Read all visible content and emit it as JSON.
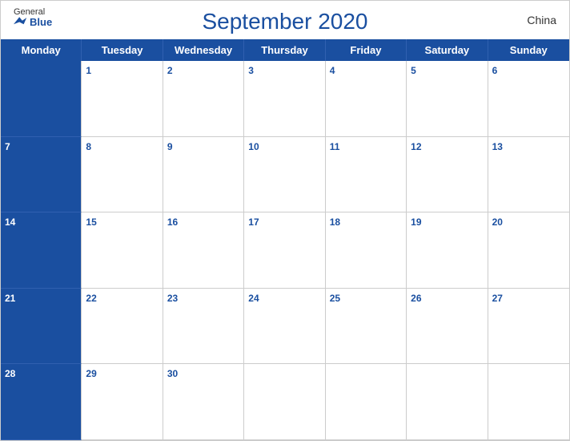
{
  "header": {
    "title": "September 2020",
    "country": "China",
    "logo": {
      "general": "General",
      "blue": "Blue"
    }
  },
  "days": {
    "headers": [
      "Monday",
      "Tuesday",
      "Wednesday",
      "Thursday",
      "Friday",
      "Saturday",
      "Sunday"
    ]
  },
  "weeks": [
    [
      {
        "num": "",
        "empty": true
      },
      {
        "num": "1"
      },
      {
        "num": "2"
      },
      {
        "num": "3"
      },
      {
        "num": "4"
      },
      {
        "num": "5"
      },
      {
        "num": "6"
      }
    ],
    [
      {
        "num": "7"
      },
      {
        "num": "8"
      },
      {
        "num": "9"
      },
      {
        "num": "10"
      },
      {
        "num": "11"
      },
      {
        "num": "12"
      },
      {
        "num": "13"
      }
    ],
    [
      {
        "num": "14"
      },
      {
        "num": "15"
      },
      {
        "num": "16"
      },
      {
        "num": "17"
      },
      {
        "num": "18"
      },
      {
        "num": "19"
      },
      {
        "num": "20"
      }
    ],
    [
      {
        "num": "21"
      },
      {
        "num": "22"
      },
      {
        "num": "23"
      },
      {
        "num": "24"
      },
      {
        "num": "25"
      },
      {
        "num": "26"
      },
      {
        "num": "27"
      }
    ],
    [
      {
        "num": "28"
      },
      {
        "num": "29"
      },
      {
        "num": "30"
      },
      {
        "num": "",
        "empty": true
      },
      {
        "num": "",
        "empty": true
      },
      {
        "num": "",
        "empty": true
      },
      {
        "num": "",
        "empty": true
      }
    ]
  ],
  "colors": {
    "header_bg": "#1a4fa0",
    "header_text": "#ffffff",
    "number_color": "#1a4fa0",
    "border": "#cccccc"
  }
}
